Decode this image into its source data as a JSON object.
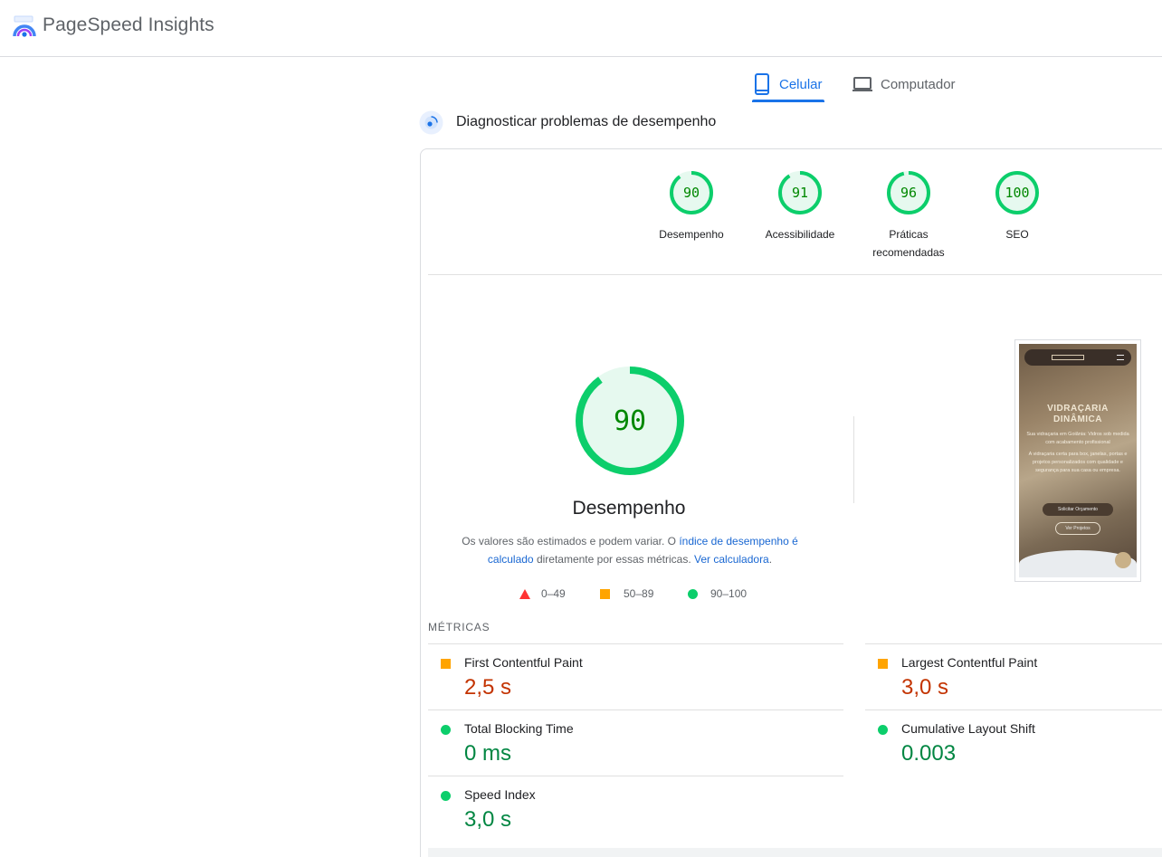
{
  "header": {
    "title": "PageSpeed Insights"
  },
  "tabs": [
    {
      "label": "Celular",
      "active": true,
      "icon": "smartphone-icon"
    },
    {
      "label": "Computador",
      "active": false,
      "icon": "laptop-icon"
    }
  ],
  "diagnose": {
    "title": "Diagnosticar problemas de desempenho"
  },
  "colors": {
    "pass": "#0cce6b",
    "average": "#ffa400",
    "fail": "#ff3333",
    "link": "#1967d2",
    "accent": "#1a73e8"
  },
  "summary_scores": [
    {
      "score": "90",
      "label": "Desempenho"
    },
    {
      "score": "91",
      "label": "Acessibilidade"
    },
    {
      "score": "96",
      "label": "Práticas recomendadas"
    },
    {
      "score": "100",
      "label": "SEO"
    }
  ],
  "performance": {
    "score": "90",
    "label": "Desempenho",
    "note_prefix": "Os valores são estimados e podem variar. O ",
    "note_link1": "índice de desempenho é calculado",
    "note_middle": " diretamente por essas métricas. ",
    "note_link2": "Ver calculadora",
    "note_suffix": "."
  },
  "legend": [
    {
      "range": "0–49",
      "shape": "triangle"
    },
    {
      "range": "50–89",
      "shape": "square"
    },
    {
      "range": "90–100",
      "shape": "circle"
    }
  ],
  "screenshot": {
    "title_line1": "VIDRAÇARIA",
    "title_line2": "DINÂMICA",
    "subtitle": "Sua vidraçaria em Goiânia: Vidros sob medida com acabamento profissional",
    "body": "A vidraçaria certa para box, janelas, portas e projetos personalizados com qualidade e segurança para sua casa ou empresa.",
    "button1": "Solicitar Orçamento",
    "button2": "Ver Projetos"
  },
  "metrics": {
    "title": "MÉTRICAS",
    "items": [
      {
        "name": "First Contentful Paint",
        "value": "2,5 s",
        "status": "average"
      },
      {
        "name": "Largest Contentful Paint",
        "value": "3,0 s",
        "status": "average"
      },
      {
        "name": "Total Blocking Time",
        "value": "0 ms",
        "status": "pass"
      },
      {
        "name": "Cumulative Layout Shift",
        "value": "0.003",
        "status": "pass"
      },
      {
        "name": "Speed Index",
        "value": "3,0 s",
        "status": "pass"
      }
    ]
  }
}
